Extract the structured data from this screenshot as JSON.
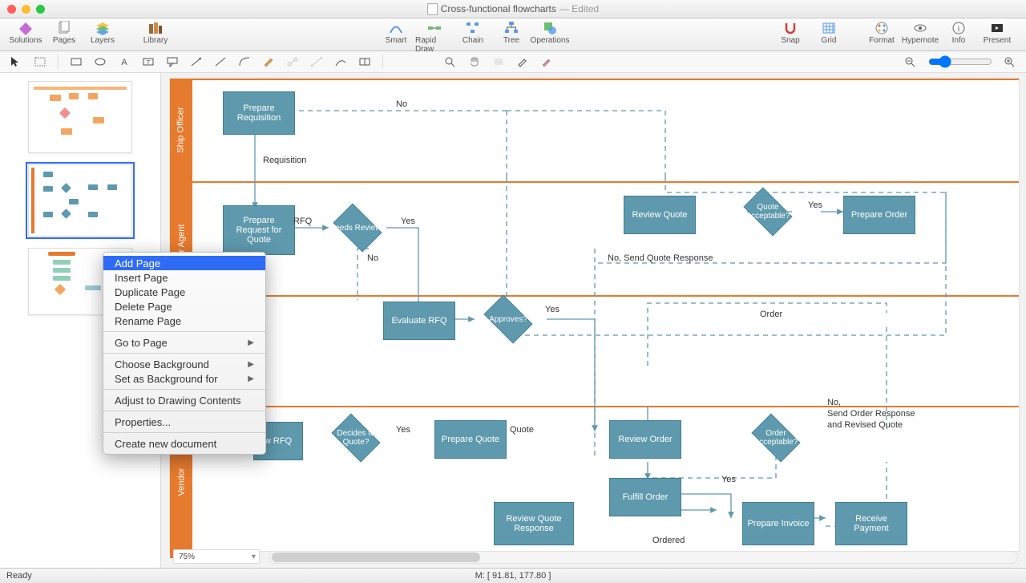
{
  "window": {
    "title": "Cross-functional flowcharts",
    "edited": "— Edited"
  },
  "toolbar": {
    "solutions": "Solutions",
    "pages": "Pages",
    "layers": "Layers",
    "library": "Library",
    "smart": "Smart",
    "rapid": "Rapid Draw",
    "chain": "Chain",
    "tree": "Tree",
    "operations": "Operations",
    "snap": "Snap",
    "grid": "Grid",
    "format": "Format",
    "hypernote": "Hypernote",
    "info": "Info",
    "present": "Present"
  },
  "contextmenu": {
    "add_page": "Add Page",
    "insert_page": "Insert Page",
    "duplicate_page": "Duplicate Page",
    "delete_page": "Delete Page",
    "rename_page": "Rename Page",
    "go_to_page": "Go to Page",
    "choose_bg": "Choose Background",
    "set_bg": "Set as Background for",
    "adjust": "Adjust to Drawing Contents",
    "properties": "Properties...",
    "create_new": "Create new document"
  },
  "swimlanes": {
    "ship": "Ship Officer",
    "agent": "r Agent",
    "vendor": "Vendor"
  },
  "nodes": {
    "prepare_req": "Prepare Requisition",
    "prepare_rfq": "Prepare Request for Quote",
    "needs_review": "Needs Review?",
    "evaluate_rfq": "Evaluate RFQ",
    "approves": "Approves?",
    "review_quote": "Review Quote",
    "quote_acc": "Quote Acceptable?",
    "prepare_order": "Prepare Order",
    "w_rfq": "w RFQ",
    "decides": "Decides to Quote?",
    "prepare_quote": "Prepare Quote",
    "review_order": "Review Order",
    "order_acc": "Order Acceptable?",
    "fulfill": "Fulfill Order",
    "rqr": "Review Quote Response",
    "prep_inv": "Prepare Invoice",
    "recv_pay": "Receive Payment"
  },
  "labels": {
    "no": "No",
    "yes": "Yes",
    "requisition": "Requisition",
    "rfq": "RFQ",
    "quote": "Quote",
    "order": "Order",
    "ordered": "Ordered",
    "no_send_quote": "No, Send Quote Response",
    "no_send_order": "No,\nSend Order Response\nand Revised Quote"
  },
  "status": {
    "ready": "Ready",
    "mouse": "M: [ 91.81, 177.80 ]",
    "zoom": "75%"
  }
}
